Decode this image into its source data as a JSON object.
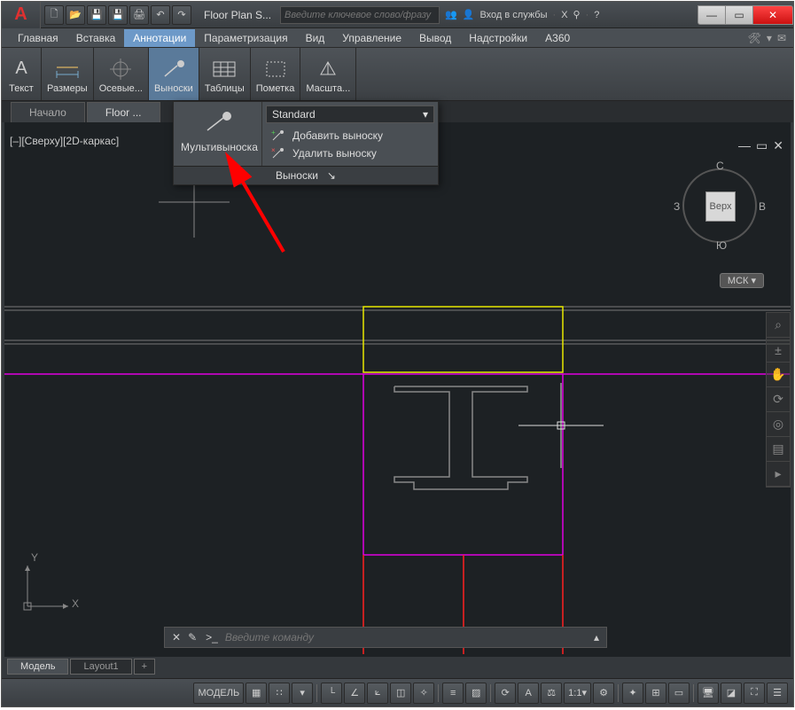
{
  "app": {
    "logo_letter": "A",
    "title": "Floor Plan S..."
  },
  "search": {
    "placeholder": "Введите ключевое слово/фразу"
  },
  "title_right": {
    "login": "Вход в службы",
    "x_icon": "X"
  },
  "win": {
    "min": "—",
    "max": "▭",
    "close": "✕"
  },
  "menu": {
    "items": [
      "Главная",
      "Вставка",
      "Аннотации",
      "Параметризация",
      "Вид",
      "Управление",
      "Вывод",
      "Надстройки",
      "A360"
    ],
    "active_index": 2
  },
  "ribbon": {
    "groups": [
      {
        "label": "Текст"
      },
      {
        "label": "Размеры"
      },
      {
        "label": "Осевые..."
      },
      {
        "label": "Выноски"
      },
      {
        "label": "Таблицы"
      },
      {
        "label": "Пометка"
      },
      {
        "label": "Масшта..."
      }
    ],
    "active_index": 3
  },
  "dropdown": {
    "main_label": "Мультивыноска",
    "style": "Standard",
    "opt_add": "Добавить выноску",
    "opt_del": "Удалить выноску",
    "footer": "Выноски"
  },
  "filetabs": {
    "start": "Начало",
    "doc": "Floor ..."
  },
  "viewport": {
    "label": "[–][Сверху][2D-каркас]",
    "cube_face": "Верх",
    "dir_n": "С",
    "dir_s": "Ю",
    "dir_e": "В",
    "dir_w": "З",
    "wcs": "МСК"
  },
  "ucs": {
    "x": "X",
    "y": "Y"
  },
  "cmd": {
    "placeholder": "Введите команду",
    "prompt": ">_"
  },
  "layout": {
    "model": "Модель",
    "layout1": "Layout1",
    "plus": "+"
  },
  "status": {
    "model": "МОДЕЛЬ",
    "scale": "1:1"
  }
}
